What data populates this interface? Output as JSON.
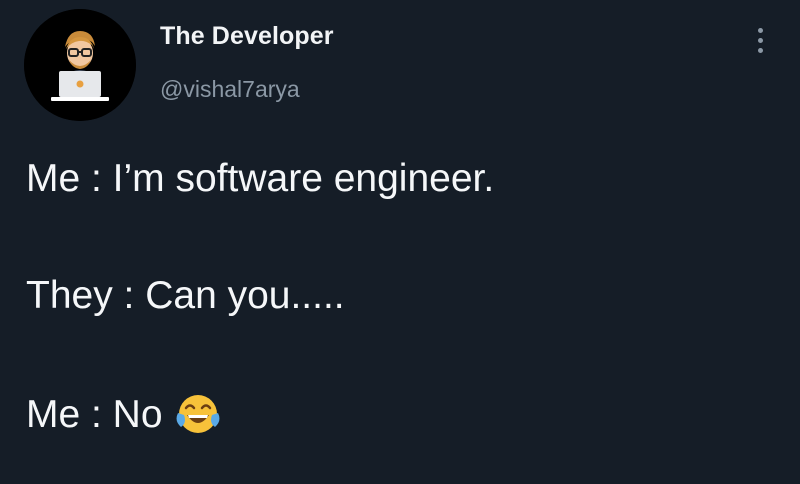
{
  "author": {
    "display_name": "The Developer",
    "handle": "@vishal7arya",
    "avatar_icon": "developer-avatar-icon"
  },
  "menu": {
    "icon": "more-vertical-icon"
  },
  "tweet": {
    "lines": [
      "Me : I’m software engineer.",
      "They : Can you.....",
      "Me : No"
    ],
    "emoji": "face-with-tears-of-joy-emoji"
  },
  "colors": {
    "background": "#151d27",
    "text": "#f5f7f9",
    "secondary_text": "#8b98a5"
  }
}
